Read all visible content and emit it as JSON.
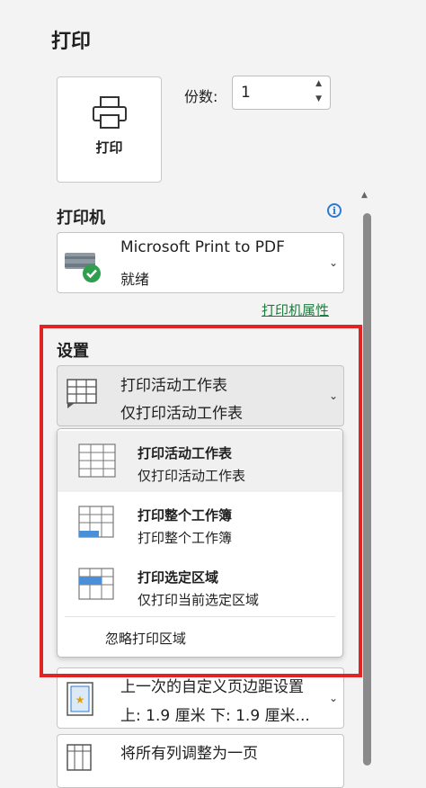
{
  "panel": {
    "title": "打印"
  },
  "print_button": {
    "label": "打印"
  },
  "copies": {
    "label": "份数:",
    "value": "1"
  },
  "printer": {
    "heading": "打印机",
    "name": "Microsoft Print to PDF",
    "status": "就绪",
    "properties_link": "打印机属性"
  },
  "settings": {
    "heading": "设置",
    "selected": {
      "line1": "打印活动工作表",
      "line2": "仅打印活动工作表"
    },
    "menu": [
      {
        "title": "打印活动工作表",
        "desc": "仅打印活动工作表"
      },
      {
        "title": "打印整个工作簿",
        "desc": "打印整个工作簿"
      },
      {
        "title": "打印选定区域",
        "desc": "仅打印当前选定区域"
      }
    ],
    "ignore_print_area": "忽略打印区域"
  },
  "margins": {
    "line1": "上一次的自定义页边距设置",
    "line2": "上: 1.9 厘米 下: 1.9 厘米..."
  },
  "scaling": {
    "line1": "将所有列调整为一页"
  },
  "colors": {
    "accent_red": "#e02424",
    "link_green": "#1f7a3f",
    "info_blue": "#2b7bd3"
  }
}
